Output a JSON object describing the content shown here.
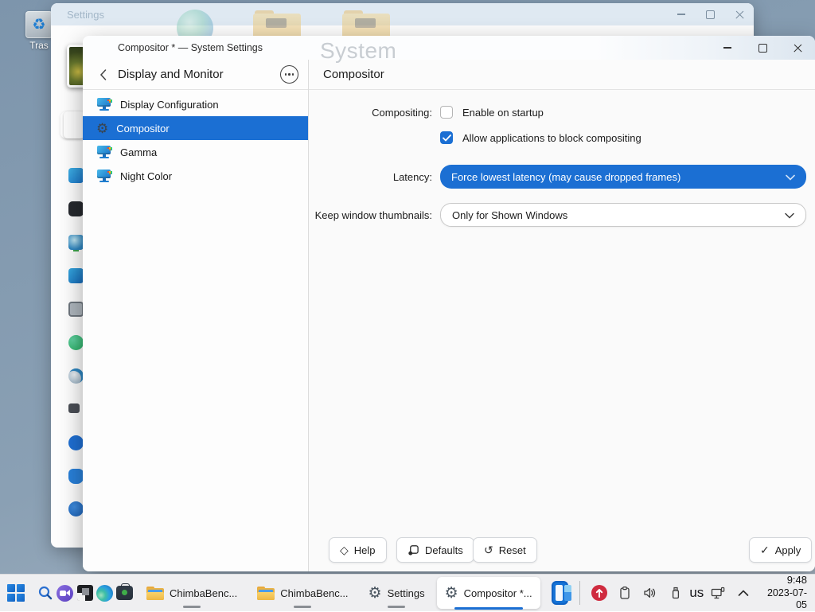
{
  "colors": {
    "accent": "#1b6fd3",
    "selection_blue": "#1b6fd3",
    "taskbar_bg": "#efeff1",
    "desktop_blue": "#8aa0b4",
    "update_badge_red": "#cf2b3f"
  },
  "desktop": {
    "trash_label": "Tras"
  },
  "background_window": {
    "title": "Settings",
    "ghost_heading": "System"
  },
  "window": {
    "title": "Compositor * — System Settings",
    "sidebar": {
      "back_header": "Display and Monitor",
      "items": [
        {
          "label": "Display Configuration",
          "selected": false
        },
        {
          "label": "Compositor",
          "selected": true
        },
        {
          "label": "Gamma",
          "selected": false
        },
        {
          "label": "Night Color",
          "selected": false
        }
      ]
    },
    "content": {
      "header": "Compositor",
      "compositing_label": "Compositing:",
      "enable_startup": {
        "label": "Enable on startup",
        "checked": false
      },
      "block_compositing": {
        "label": "Allow applications to block compositing",
        "checked": true
      },
      "latency_label": "Latency:",
      "latency_value": "Force lowest latency (may cause dropped frames)",
      "thumbnails_label": "Keep window thumbnails:",
      "thumbnails_value": "Only for Shown Windows",
      "footer": {
        "help": "Help",
        "defaults": "Defaults",
        "reset": "Reset",
        "apply": "Apply"
      }
    }
  },
  "taskbar": {
    "apps": [
      {
        "label": "ChimbaBenc...",
        "running": true,
        "active": false
      },
      {
        "label": "ChimbaBenc...",
        "running": true,
        "active": false
      },
      {
        "label": "Settings",
        "running": true,
        "active": false
      },
      {
        "label": "Compositor *...",
        "running": true,
        "active": true
      }
    ],
    "tray": {
      "keyboard_layout": "us",
      "time": "9:48",
      "date": "2023-07-05"
    }
  }
}
